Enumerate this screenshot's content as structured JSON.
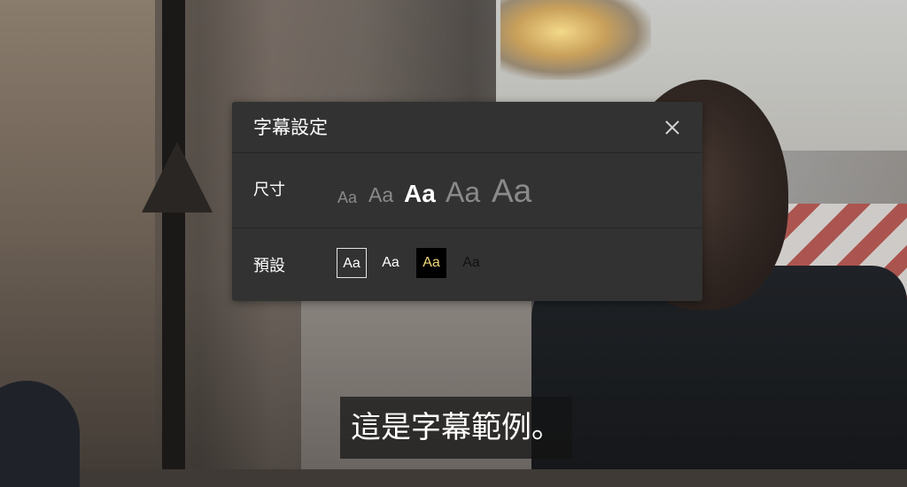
{
  "dialog": {
    "title": "字幕設定",
    "close_icon": "close-icon",
    "size_label": "尺寸",
    "size_options": [
      "Aa",
      "Aa",
      "Aa",
      "Aa",
      "Aa"
    ],
    "size_selected_index": 2,
    "preset_label": "預設",
    "preset_options": [
      "Aa",
      "Aa",
      "Aa",
      "Aa"
    ],
    "preset_selected_index": 0
  },
  "subtitle": {
    "text": "這是字幕範例。"
  },
  "colors": {
    "dialog_bg": "#323232",
    "preset_yellow_text": "#f0d97a"
  }
}
